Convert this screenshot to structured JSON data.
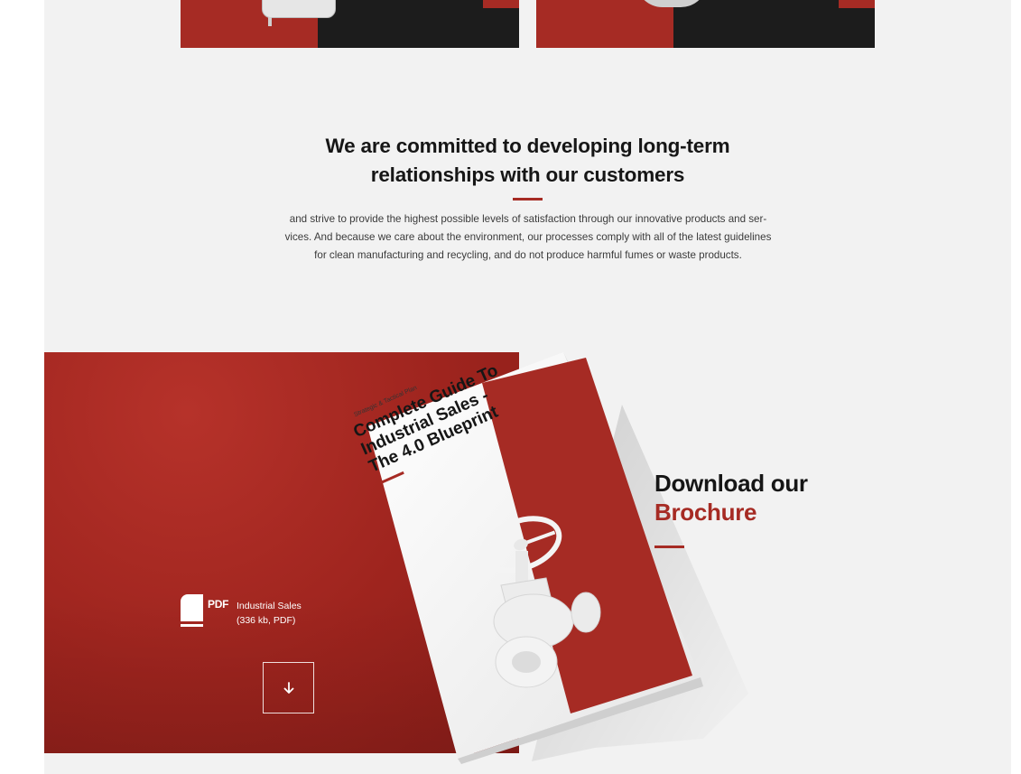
{
  "commitment": {
    "headline_line1": "We are committed to developing long-term",
    "headline_line2": "relationships with our customers",
    "intro_line1": "and strive to provide the highest possible levels of satisfaction through our innovative products and ser-",
    "intro_line2": "vices. And because we care about the environment, our processes comply with all of the latest guidelines",
    "intro_line3": "for clean manufacturing and recycling, and do not produce harmful fumes or waste products."
  },
  "brochure": {
    "cover_kicker": "Strategic & Tactical Plan",
    "cover_title_line1": "Complete Guide To",
    "cover_title_line2": "Industrial Sales -",
    "cover_title_line3": "The 4.0 Blueprint",
    "file_icon": "pdf-icon",
    "file_tag": "PDF",
    "file_name": "Industrial Sales",
    "file_meta": "(336 kb, PDF)",
    "download_icon": "arrow-down-icon",
    "heading_line1": "Download our",
    "heading_line2": "Brochure"
  },
  "colors": {
    "accent": "#a62b24",
    "dark": "#1c1c1c",
    "background": "#f2f2f2",
    "text": "#161616"
  }
}
